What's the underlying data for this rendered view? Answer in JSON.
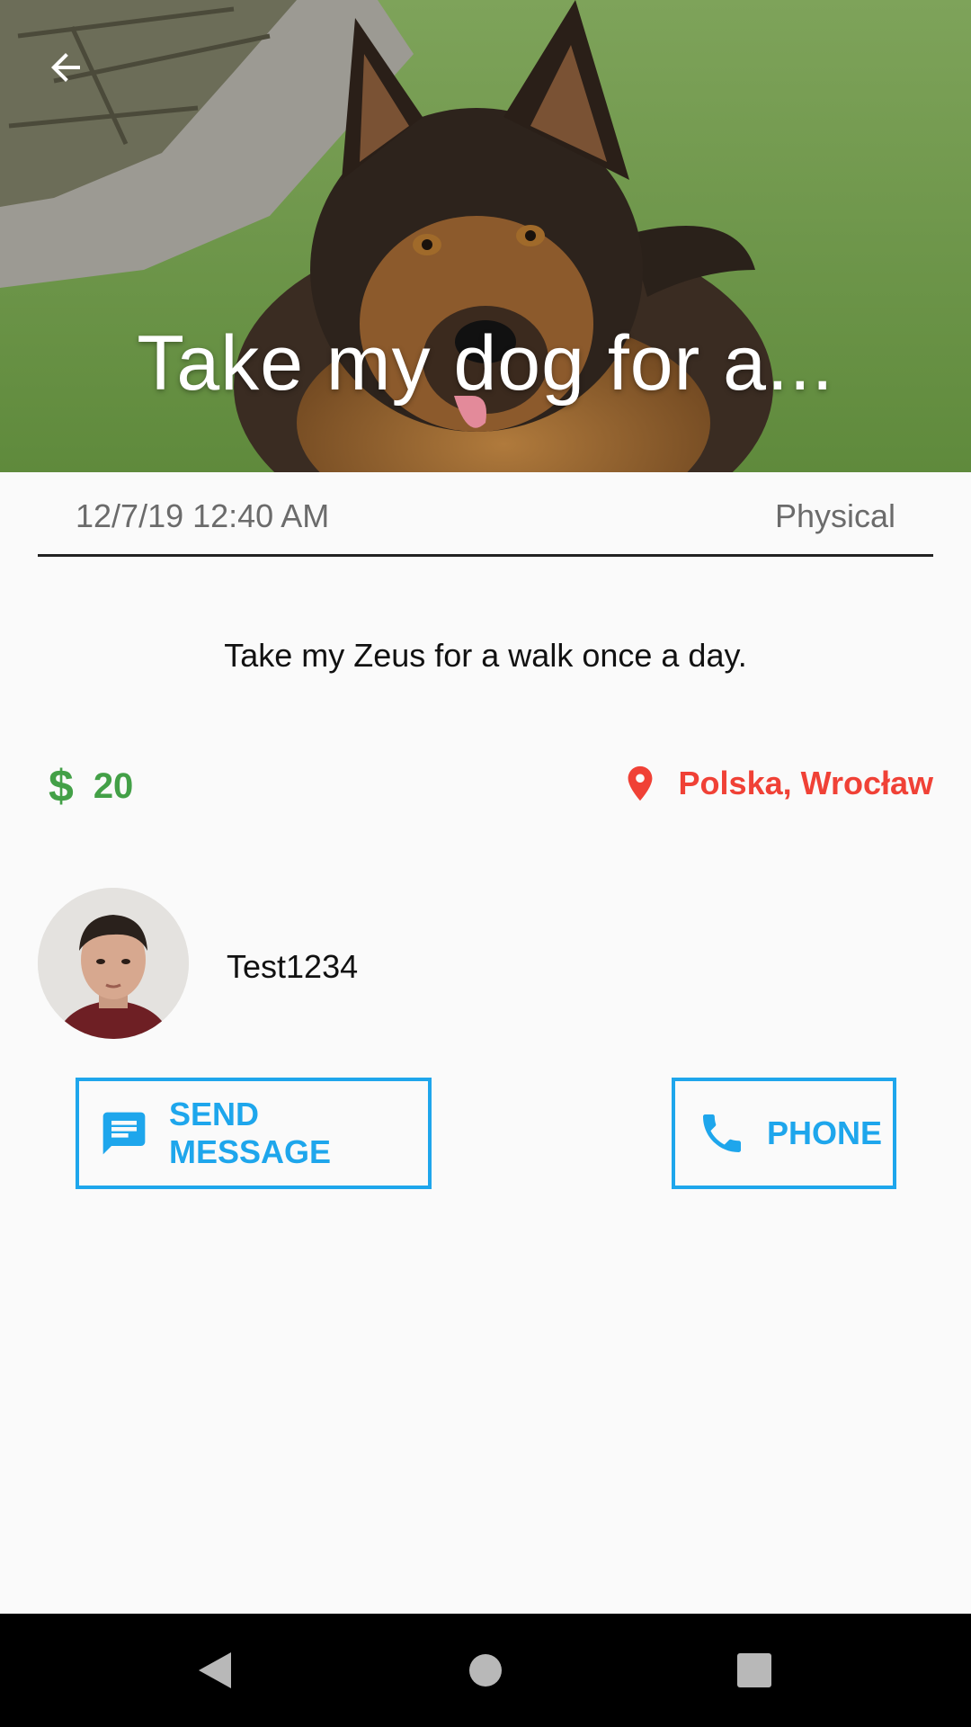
{
  "post": {
    "title": "Take my dog for a...",
    "date": "12/7/19 12:40 AM",
    "type": "Physical",
    "description": "Take my Zeus for a walk once a day.",
    "price_symbol": "$",
    "price": "20",
    "location": "Polska, Wrocław"
  },
  "user": {
    "name": "Test1234"
  },
  "actions": {
    "message_label": "SEND MESSAGE",
    "phone_label": "PHONE"
  },
  "colors": {
    "accent": "#1ea6ec",
    "price": "#43a047",
    "location": "#f04136"
  },
  "icons": {
    "back": "arrow-left-icon",
    "location": "map-pin-icon",
    "message": "message-icon",
    "phone": "phone-icon",
    "nav_back": "triangle-back-icon",
    "nav_home": "circle-home-icon",
    "nav_recent": "square-recent-icon"
  }
}
